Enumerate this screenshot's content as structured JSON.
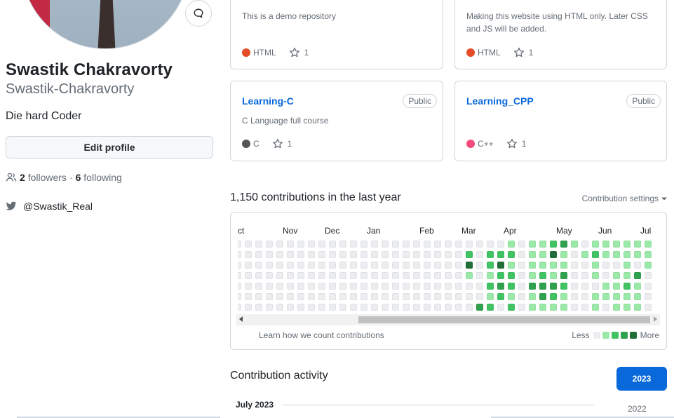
{
  "profile": {
    "name": "Swastik Chakravorty",
    "login": "Swastik-Chakravorty",
    "bio": "Die hard Coder",
    "edit_label": "Edit profile",
    "followers_count": "2",
    "followers_label": "followers",
    "separator": "·",
    "following_count": "6",
    "following_label": "following",
    "twitter": "@Swastik_Real"
  },
  "repos": [
    {
      "description": "This is a demo repository",
      "language": "HTML",
      "language_color": "#e34c26",
      "stars": "1"
    },
    {
      "description": "Making this website using HTML only. Later CSS and JS will be added.",
      "language": "HTML",
      "language_color": "#e34c26",
      "stars": "1"
    },
    {
      "name": "Learning-C",
      "visibility": "Public",
      "description": "C Language full course",
      "language": "C",
      "language_color": "#555555",
      "stars": "1"
    },
    {
      "name": "Learning_CPP",
      "visibility": "Public",
      "description": "",
      "language": "C++",
      "language_color": "#f34b7d",
      "stars": "1"
    }
  ],
  "contributions": {
    "title": "1,150 contributions in the last year",
    "settings_label": "Contribution settings",
    "months": [
      "ct",
      "Nov",
      "Dec",
      "Jan",
      "Feb",
      "Mar",
      "Apr",
      "May",
      "Jun",
      "Jul"
    ],
    "learn_link": "Learn how we count contributions",
    "legend_less": "Less",
    "legend_more": "More",
    "level_colors": [
      "#ebedf0",
      "#9be9a8",
      "#40c463",
      "#30a14e",
      "#216e39"
    ],
    "weeks": [
      [
        0,
        0,
        0,
        0,
        0,
        0,
        0
      ],
      [
        0,
        0,
        0,
        0,
        0,
        0,
        0
      ],
      [
        0,
        0,
        0,
        0,
        0,
        0,
        0
      ],
      [
        0,
        0,
        0,
        0,
        0,
        0,
        0
      ],
      [
        0,
        0,
        0,
        0,
        0,
        0,
        0
      ],
      [
        0,
        0,
        0,
        0,
        0,
        0,
        0
      ],
      [
        0,
        0,
        0,
        0,
        0,
        0,
        0
      ],
      [
        0,
        0,
        0,
        0,
        0,
        0,
        0
      ],
      [
        0,
        0,
        0,
        0,
        0,
        0,
        0
      ],
      [
        0,
        0,
        0,
        0,
        0,
        0,
        0
      ],
      [
        0,
        0,
        0,
        0,
        0,
        0,
        0
      ],
      [
        0,
        0,
        0,
        0,
        0,
        0,
        0
      ],
      [
        0,
        0,
        0,
        0,
        0,
        0,
        0
      ],
      [
        0,
        0,
        0,
        0,
        0,
        0,
        0
      ],
      [
        0,
        0,
        0,
        0,
        0,
        0,
        0
      ],
      [
        0,
        0,
        0,
        0,
        0,
        0,
        0
      ],
      [
        0,
        0,
        0,
        0,
        0,
        0,
        0
      ],
      [
        0,
        0,
        0,
        0,
        0,
        0,
        0
      ],
      [
        0,
        0,
        0,
        0,
        0,
        0,
        0
      ],
      [
        0,
        0,
        0,
        0,
        0,
        0,
        0
      ],
      [
        0,
        0,
        0,
        0,
        0,
        0,
        0
      ],
      [
        0,
        0,
        0,
        0,
        0,
        0,
        0
      ],
      [
        0,
        2,
        4,
        1,
        0,
        0,
        0
      ],
      [
        0,
        0,
        0,
        0,
        0,
        0,
        3
      ],
      [
        0,
        2,
        2,
        1,
        2,
        1,
        2
      ],
      [
        0,
        2,
        4,
        2,
        3,
        2,
        0
      ],
      [
        1,
        2,
        1,
        2,
        2,
        1,
        2
      ],
      [
        0,
        0,
        0,
        0,
        0,
        0,
        0
      ],
      [
        1,
        1,
        1,
        1,
        3,
        1,
        1
      ],
      [
        1,
        1,
        1,
        2,
        3,
        3,
        1
      ],
      [
        2,
        4,
        1,
        1,
        3,
        2,
        1
      ],
      [
        3,
        1,
        1,
        3,
        2,
        1,
        1
      ],
      [
        1,
        0,
        0,
        0,
        0,
        0,
        0
      ],
      [
        0,
        1,
        0,
        0,
        0,
        0,
        0
      ],
      [
        1,
        2,
        1,
        1,
        0,
        1,
        1
      ],
      [
        1,
        1,
        0,
        0,
        1,
        1,
        0
      ],
      [
        1,
        1,
        0,
        1,
        1,
        1,
        1
      ],
      [
        1,
        1,
        1,
        1,
        2,
        1,
        1
      ],
      [
        1,
        1,
        0,
        3,
        1,
        1,
        1
      ],
      [
        1,
        1,
        1,
        0,
        0,
        0,
        0
      ]
    ]
  },
  "activity": {
    "title": "Contribution activity",
    "active_year": "2023",
    "other_year": "2022",
    "month_heading": "July 2023"
  }
}
